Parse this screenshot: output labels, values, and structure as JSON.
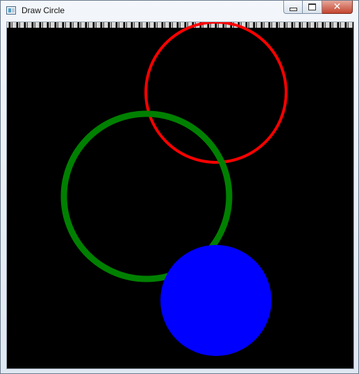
{
  "window": {
    "title": "Draw Circle",
    "controls": {
      "minimize": "minimize",
      "maximize": "restore",
      "close": "close"
    }
  },
  "canvas": {
    "background_color": "#000000",
    "circles": [
      {
        "name": "red-circle",
        "stroke": "#ff0000",
        "fill": "none"
      },
      {
        "name": "green-circle",
        "stroke": "#008000",
        "fill": "none"
      },
      {
        "name": "blue-circle",
        "stroke": "none",
        "fill": "#0000ff"
      }
    ]
  }
}
